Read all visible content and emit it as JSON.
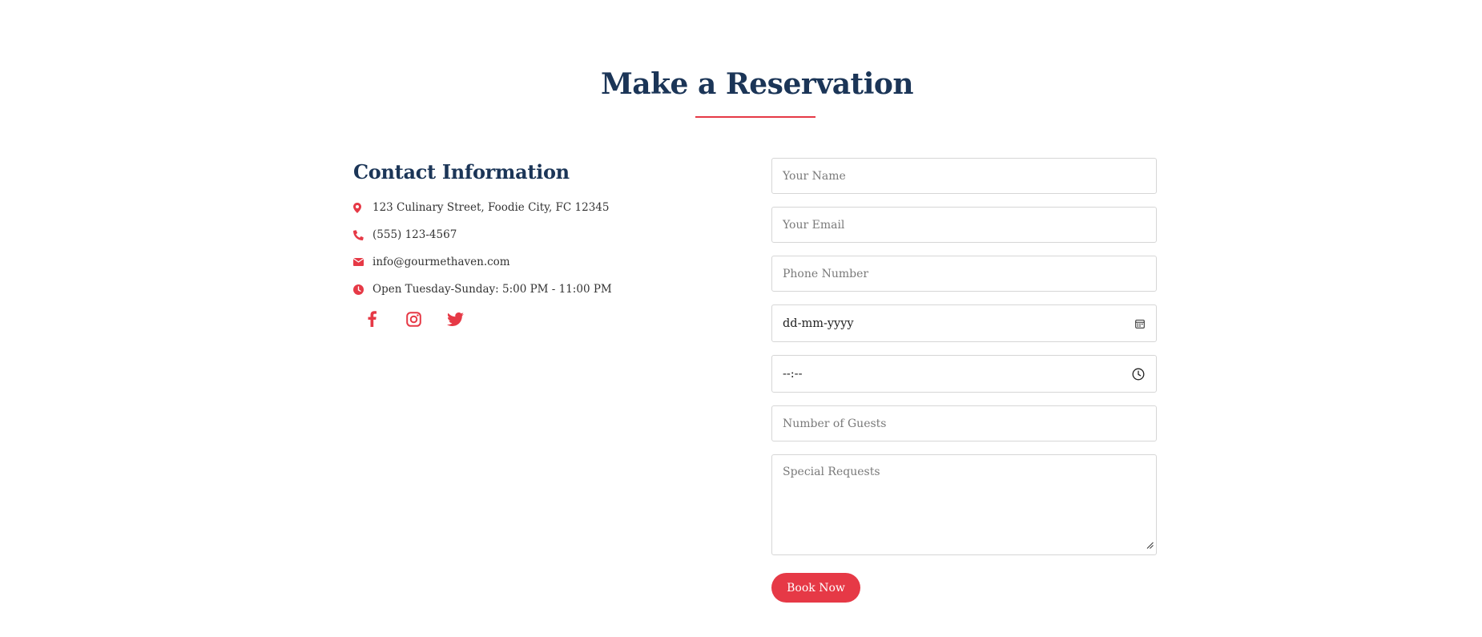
{
  "section": {
    "title": "Make a Reservation",
    "accent_color": "#e63946",
    "heading_color": "#1b3557"
  },
  "contact": {
    "title": "Contact Information",
    "items": [
      {
        "icon": "map-marker-icon",
        "text": "123 Culinary Street, Foodie City, FC 12345"
      },
      {
        "icon": "phone-icon",
        "text": "(555) 123-4567"
      },
      {
        "icon": "envelope-icon",
        "text": "info@gourmethaven.com"
      },
      {
        "icon": "clock-icon",
        "text": "Open Tuesday-Sunday: 5:00 PM - 11:00 PM"
      }
    ],
    "social": [
      "facebook-icon",
      "instagram-icon",
      "twitter-icon"
    ]
  },
  "form": {
    "name_placeholder": "Your Name",
    "email_placeholder": "Your Email",
    "phone_placeholder": "Phone Number",
    "date_value": "dd-mm-yyyy",
    "time_value": "--:--",
    "guests_placeholder": "Number of Guests",
    "requests_placeholder": "Special Requests",
    "submit_label": "Book Now"
  }
}
